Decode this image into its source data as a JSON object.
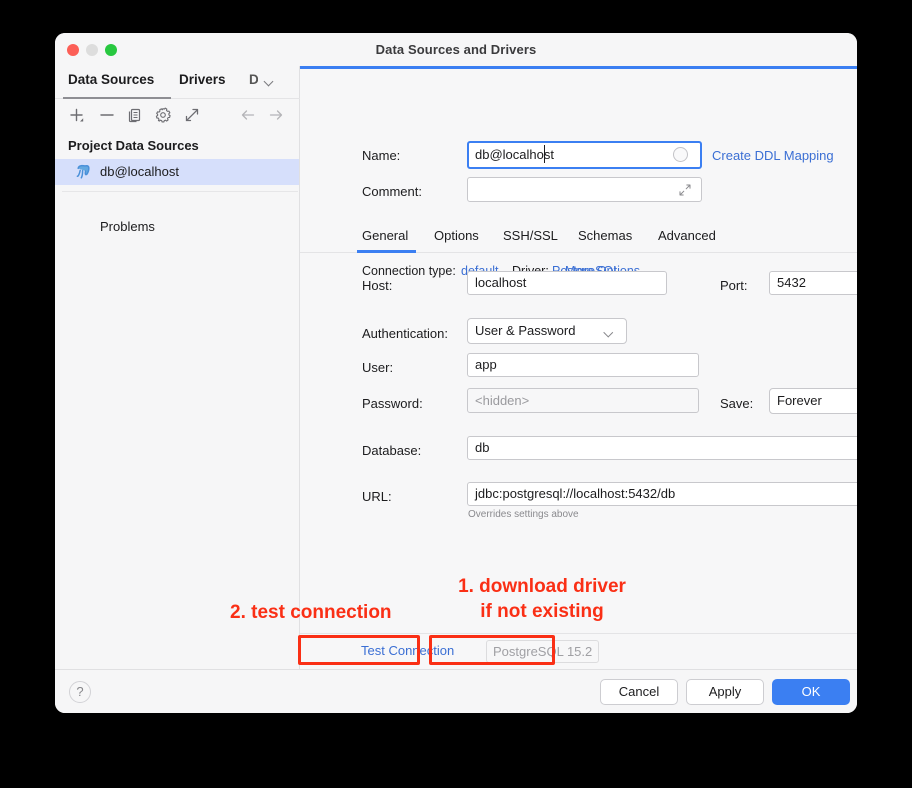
{
  "window": {
    "title": "Data Sources and Drivers",
    "traffic_lights": [
      "close",
      "minimize",
      "maximize"
    ]
  },
  "sidebar": {
    "tabs": [
      {
        "label": "Data Sources",
        "selected": true
      },
      {
        "label": "Drivers",
        "selected": false
      },
      {
        "label": "D",
        "selected": false,
        "clipped": true
      }
    ],
    "toolbar": [
      {
        "name": "add-icon",
        "tooltip": "Add"
      },
      {
        "name": "remove-icon",
        "tooltip": "Remove"
      },
      {
        "name": "copy-icon",
        "tooltip": "Duplicate"
      },
      {
        "name": "gear-icon",
        "tooltip": "Settings"
      },
      {
        "name": "external-link-icon",
        "tooltip": "Share"
      },
      {
        "name": "arrow-left-icon",
        "tooltip": "Back"
      },
      {
        "name": "arrow-right-icon",
        "tooltip": "Forward"
      }
    ],
    "group_label": "Project Data Sources",
    "items": [
      {
        "label": "db@localhost",
        "icon": "postgresql-elephant-icon",
        "selected": true
      }
    ],
    "problems_label": "Problems"
  },
  "form": {
    "name_label": "Name:",
    "name_value": "db@localhost",
    "create_ddl_link": "Create DDL Mapping",
    "comment_label": "Comment:",
    "comment_value": "",
    "tabs": [
      {
        "label": "General",
        "selected": true
      },
      {
        "label": "Options",
        "selected": false
      },
      {
        "label": "SSH/SSL",
        "selected": false
      },
      {
        "label": "Schemas",
        "selected": false
      },
      {
        "label": "Advanced",
        "selected": false
      }
    ],
    "connection_type_label": "Connection type:",
    "connection_type_value": "default",
    "driver_label": "Driver:",
    "driver_value": "PostgreSQL",
    "more_options_label": "More Options",
    "host_label": "Host:",
    "host_value": "localhost",
    "port_label": "Port:",
    "port_value": "5432",
    "auth_label": "Authentication:",
    "auth_value": "User & Password",
    "user_label": "User:",
    "user_value": "app",
    "password_label": "Password:",
    "password_placeholder": "<hidden>",
    "save_label": "Save:",
    "save_value": "Forever",
    "database_label": "Database:",
    "database_value": "db",
    "url_label": "URL:",
    "url_value": "jdbc:postgresql://localhost:5432/db",
    "url_hint": "Overrides settings above"
  },
  "actions": {
    "test_connection_label": "Test Connection",
    "driver_badge_label": "PostgreSQL 15.2",
    "revert_icon": "revert-arrow-icon"
  },
  "annotations": {
    "color": "#fa2f15",
    "note_1": "1. download driver\nif not existing",
    "note_1_line1": "1. download driver",
    "note_1_line2": "if not existing",
    "note_2": "2. test connection"
  },
  "footer": {
    "help_label": "?",
    "cancel_label": "Cancel",
    "apply_label": "Apply",
    "ok_label": "OK"
  },
  "colors": {
    "accent": "#3b7ff2",
    "link": "#3b6fd4",
    "annotation_red": "#fa2f15",
    "selection": "#d6dffb",
    "window_bg": "#f6f6f7"
  }
}
